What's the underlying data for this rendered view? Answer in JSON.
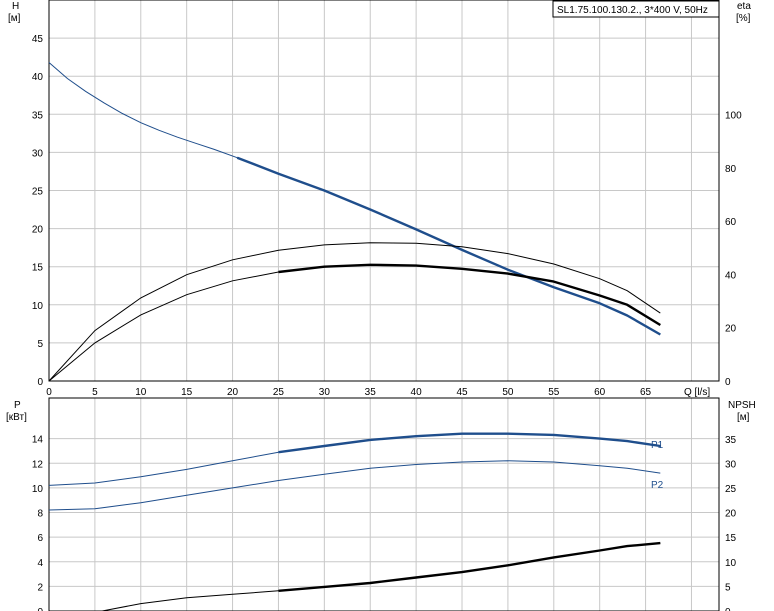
{
  "chart_data": [
    {
      "type": "line",
      "title": "SL1.75.100.130.2., 3*400 V, 50Hz",
      "xlabel": "Q [l/s]",
      "ylabel": "H [м]",
      "ylabel_parts": [
        "H",
        "[м]"
      ],
      "y2label": "eta [%]",
      "y2label_parts": [
        "eta",
        "[%]"
      ],
      "xlim": [
        0,
        73
      ],
      "ylim": [
        0,
        50
      ],
      "y2lim": [
        0,
        143
      ],
      "xticks": [
        0,
        5,
        10,
        15,
        20,
        25,
        30,
        35,
        40,
        45,
        50,
        55,
        60,
        65
      ],
      "yticks": [
        0,
        5,
        10,
        15,
        20,
        25,
        30,
        35,
        40,
        45
      ],
      "y2ticks": [
        0,
        20,
        40,
        60,
        80,
        100
      ],
      "xgrid_step": 5,
      "grid": true,
      "series": [
        {
          "axis": "left",
          "color": "#1f4e8c",
          "x": [
            0,
            2,
            4,
            6,
            8,
            10,
            12,
            14,
            16,
            18,
            20.5,
            25,
            30,
            35,
            40,
            45,
            50,
            55,
            60,
            63,
            66.6
          ],
          "y": [
            41.8,
            39.7,
            38.0,
            36.5,
            35.1,
            33.9,
            32.9,
            32.0,
            31.2,
            30.4,
            29.3,
            27.2,
            25.0,
            22.5,
            19.9,
            17.2,
            14.6,
            12.3,
            10.2,
            8.6,
            6.1
          ],
          "bold_from_x": 20.5
        },
        {
          "axis": "right",
          "color": "#000000",
          "x": [
            0,
            5,
            10,
            15,
            20,
            25,
            30,
            35,
            40,
            45,
            50,
            55,
            60,
            63,
            66.6
          ],
          "y": [
            0,
            18.9,
            31.2,
            39.9,
            45.5,
            49.1,
            51.1,
            51.9,
            51.7,
            50.4,
            47.8,
            43.9,
            38.4,
            33.9,
            25.5
          ]
        },
        {
          "axis": "right",
          "color": "#000000",
          "x": [
            0,
            5,
            10,
            15,
            20,
            25,
            30,
            35,
            40,
            45,
            50,
            55,
            60,
            63,
            66.6
          ],
          "y": [
            0,
            14.3,
            24.8,
            32.4,
            37.6,
            40.9,
            42.9,
            43.6,
            43.3,
            42.1,
            40.3,
            37.3,
            32.1,
            28.6,
            21.0
          ],
          "bold_from_x": 20.5
        }
      ]
    },
    {
      "type": "line",
      "ylabel": "P [кВт]",
      "ylabel_parts": [
        "P",
        "[кВт]"
      ],
      "y2label": "NPSH [м]",
      "y2label_parts": [
        "NPSH",
        "[м]"
      ],
      "xlim": [
        0,
        73
      ],
      "ylim": [
        0,
        17.3
      ],
      "y2lim": [
        0,
        43.3
      ],
      "yticks": [
        0,
        2,
        4,
        6,
        8,
        10,
        12,
        14
      ],
      "y2ticks": [
        0,
        5,
        10,
        15,
        20,
        25,
        30,
        35
      ],
      "grid": true,
      "series": [
        {
          "name": "P1",
          "axis": "left",
          "color": "#1f4e8c",
          "x": [
            0,
            5,
            10,
            15,
            20,
            25,
            30,
            35,
            40,
            45,
            50,
            55,
            60,
            63,
            66.6
          ],
          "y": [
            10.2,
            10.4,
            10.9,
            11.5,
            12.2,
            12.9,
            13.4,
            13.9,
            14.2,
            14.4,
            14.4,
            14.3,
            14.0,
            13.8,
            13.4
          ],
          "bold_from_x": 20.5
        },
        {
          "name": "P2",
          "axis": "left",
          "color": "#1f4e8c",
          "x": [
            0,
            5,
            10,
            15,
            20,
            25,
            30,
            35,
            40,
            45,
            50,
            55,
            60,
            63,
            66.6
          ],
          "y": [
            8.2,
            8.3,
            8.8,
            9.4,
            10.0,
            10.6,
            11.1,
            11.6,
            11.9,
            12.1,
            12.2,
            12.1,
            11.8,
            11.6,
            11.2
          ]
        },
        {
          "axis": "right",
          "color": "#000000",
          "x": [
            5.8,
            10,
            15,
            20,
            25,
            30,
            35,
            40,
            45,
            50,
            55,
            60,
            63,
            66.6
          ],
          "y": [
            0,
            1.5,
            2.7,
            3.4,
            4.1,
            4.9,
            5.7,
            6.8,
            7.9,
            9.3,
            10.9,
            12.3,
            13.2,
            13.8
          ],
          "bold_from_x": 20.5
        }
      ]
    }
  ]
}
